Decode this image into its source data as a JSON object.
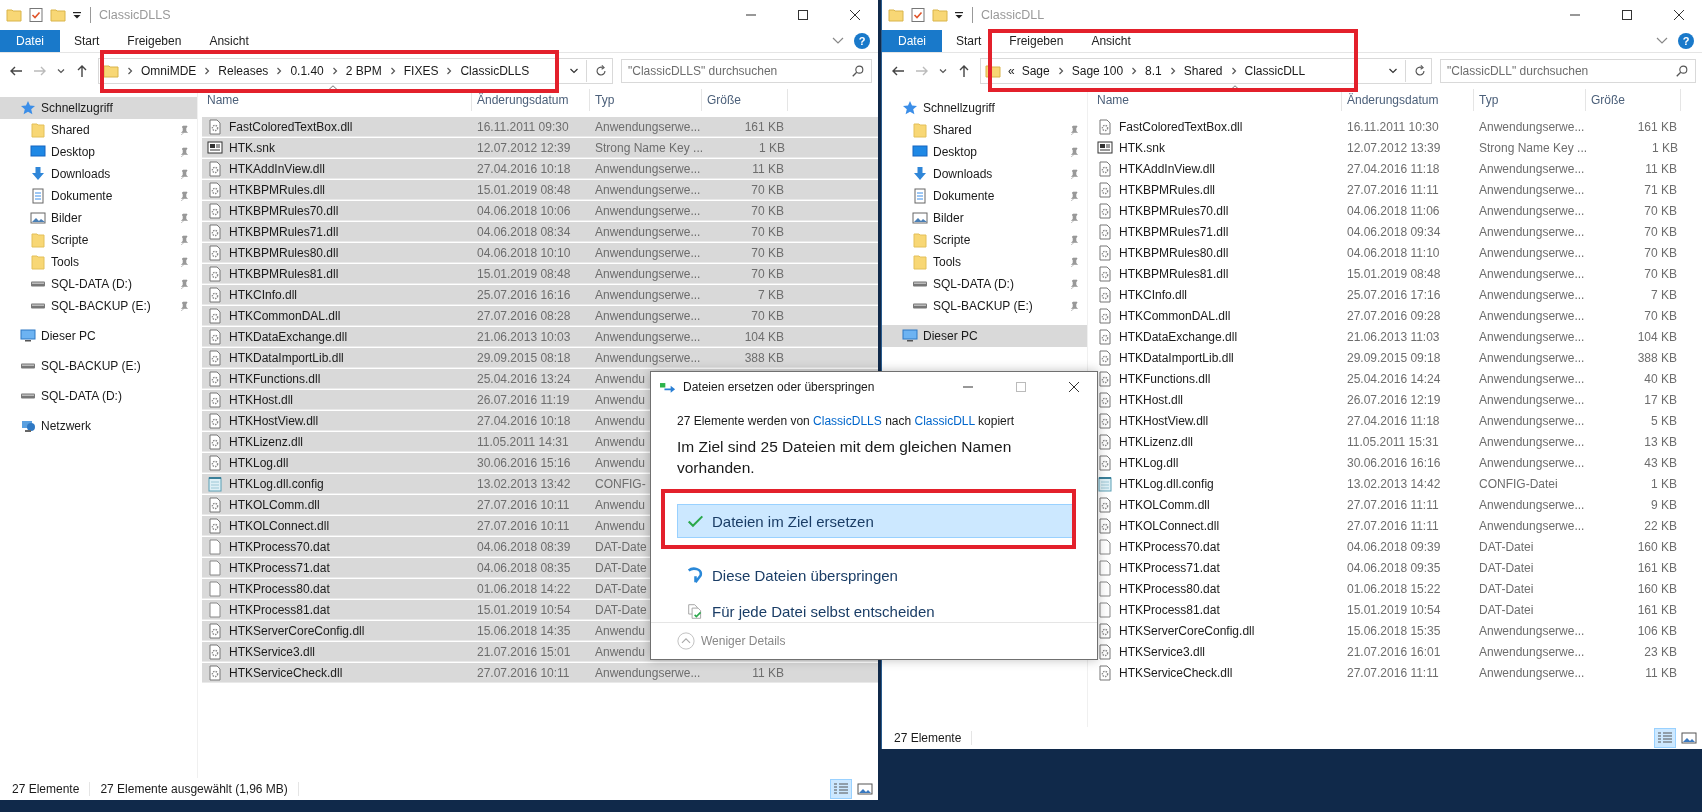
{
  "windows": [
    {
      "title": "ClassicDLLS",
      "ribbon_tabs": [
        {
          "label": "Datei",
          "selected": true
        },
        {
          "label": "Start",
          "selected": false
        },
        {
          "label": "Freigeben",
          "selected": false
        },
        {
          "label": "Ansicht",
          "selected": false
        }
      ],
      "help": "?",
      "address": {
        "segments": [
          "OmniMDE",
          "Releases",
          "0.1.40",
          "2 BPM",
          "FIXES",
          "ClassicDLLS"
        ]
      },
      "search": {
        "placeholder": "\"ClassicDLLS\" durchsuchen"
      },
      "sidebar": [
        {
          "label": "Schnellzugriff",
          "kind": "star",
          "selected": true,
          "children": [
            {
              "label": "Shared",
              "kind": "folder",
              "selected": false,
              "pinned": true
            },
            {
              "label": "Desktop",
              "kind": "desktop",
              "selected": false,
              "pinned": true
            },
            {
              "label": "Downloads",
              "kind": "download",
              "selected": false,
              "pinned": true
            },
            {
              "label": "Dokumente",
              "kind": "document",
              "selected": false,
              "pinned": true
            },
            {
              "label": "Bilder",
              "kind": "pictures",
              "selected": false,
              "pinned": true
            },
            {
              "label": "Scripte",
              "kind": "folder",
              "selected": false,
              "pinned": true
            },
            {
              "label": "Tools",
              "kind": "folder",
              "selected": false,
              "pinned": true
            },
            {
              "label": "SQL-DATA (D:)",
              "kind": "drive",
              "selected": false,
              "pinned": true
            },
            {
              "label": "SQL-BACKUP (E:)",
              "kind": "drive",
              "selected": false,
              "pinned": true
            }
          ]
        },
        {
          "label": "Dieser PC",
          "kind": "pc",
          "selected": false
        },
        {
          "label": "SQL-BACKUP (E:)",
          "kind": "drive",
          "selected": false
        },
        {
          "label": "SQL-DATA (D:)",
          "kind": "drive",
          "selected": false
        },
        {
          "label": "Netzwerk",
          "kind": "network",
          "selected": false
        }
      ],
      "columns": [
        "Name",
        "Änderungsdatum",
        "Typ",
        "Größe"
      ],
      "rows": [
        {
          "name": "FastColoredTextBox.dll",
          "date": "16.11.2011 09:30",
          "type": "Anwendungserwe...",
          "size": "161 KB",
          "kind": "dll",
          "selected": true
        },
        {
          "name": "HTK.snk",
          "date": "12.07.2012 12:39",
          "type": "Strong Name Key ...",
          "size": "1 KB",
          "kind": "snk",
          "selected": true
        },
        {
          "name": "HTKAddInView.dll",
          "date": "27.04.2016 10:18",
          "type": "Anwendungserwe...",
          "size": "11 KB",
          "kind": "dll",
          "selected": true
        },
        {
          "name": "HTKBPMRules.dll",
          "date": "15.01.2019 08:48",
          "type": "Anwendungserwe...",
          "size": "70 KB",
          "kind": "dll",
          "selected": true
        },
        {
          "name": "HTKBPMRules70.dll",
          "date": "04.06.2018 10:06",
          "type": "Anwendungserwe...",
          "size": "70 KB",
          "kind": "dll",
          "selected": true
        },
        {
          "name": "HTKBPMRules71.dll",
          "date": "04.06.2018 08:34",
          "type": "Anwendungserwe...",
          "size": "70 KB",
          "kind": "dll",
          "selected": true
        },
        {
          "name": "HTKBPMRules80.dll",
          "date": "04.06.2018 10:10",
          "type": "Anwendungserwe...",
          "size": "70 KB",
          "kind": "dll",
          "selected": true
        },
        {
          "name": "HTKBPMRules81.dll",
          "date": "15.01.2019 08:48",
          "type": "Anwendungserwe...",
          "size": "70 KB",
          "kind": "dll",
          "selected": true
        },
        {
          "name": "HTKCInfo.dll",
          "date": "25.07.2016 16:16",
          "type": "Anwendungserwe...",
          "size": "7 KB",
          "kind": "dll",
          "selected": true
        },
        {
          "name": "HTKCommonDAL.dll",
          "date": "27.07.2016 08:28",
          "type": "Anwendungserwe...",
          "size": "70 KB",
          "kind": "dll",
          "selected": true
        },
        {
          "name": "HTKDataExchange.dll",
          "date": "21.06.2013 10:03",
          "type": "Anwendungserwe...",
          "size": "104 KB",
          "kind": "dll",
          "selected": true
        },
        {
          "name": "HTKDataImportLib.dll",
          "date": "29.09.2015 08:18",
          "type": "Anwendungserwe...",
          "size": "388 KB",
          "kind": "dll",
          "selected": true
        },
        {
          "name": "HTKFunctions.dll",
          "date": "25.04.2016 13:24",
          "type": "Anwendu",
          "kind": "dll",
          "selected": true
        },
        {
          "name": "HTKHost.dll",
          "date": "26.07.2016 11:19",
          "type": "Anwendu",
          "kind": "dll",
          "selected": true
        },
        {
          "name": "HTKHostView.dll",
          "date": "27.04.2016 10:18",
          "type": "Anwendu",
          "kind": "dll",
          "selected": true
        },
        {
          "name": "HTKLizenz.dll",
          "date": "11.05.2011 14:31",
          "type": "Anwendu",
          "kind": "dll",
          "selected": true
        },
        {
          "name": "HTKLog.dll",
          "date": "30.06.2016 15:16",
          "type": "Anwendu",
          "kind": "dll",
          "selected": true
        },
        {
          "name": "HTKLog.dll.config",
          "date": "13.02.2013 13:42",
          "type": "CONFIG-",
          "kind": "config",
          "selected": true
        },
        {
          "name": "HTKOLComm.dll",
          "date": "27.07.2016 10:11",
          "type": "Anwendu",
          "kind": "dll",
          "selected": true
        },
        {
          "name": "HTKOLConnect.dll",
          "date": "27.07.2016 10:11",
          "type": "Anwendu",
          "kind": "dll",
          "selected": true
        },
        {
          "name": "HTKProcess70.dat",
          "date": "04.06.2018 08:39",
          "type": "DAT-Date",
          "kind": "dat",
          "selected": true
        },
        {
          "name": "HTKProcess71.dat",
          "date": "04.06.2018 08:35",
          "type": "DAT-Date",
          "kind": "dat",
          "selected": true
        },
        {
          "name": "HTKProcess80.dat",
          "date": "01.06.2018 14:22",
          "type": "DAT-Date",
          "kind": "dat",
          "selected": true
        },
        {
          "name": "HTKProcess81.dat",
          "date": "15.01.2019 10:54",
          "type": "DAT-Date",
          "kind": "dat",
          "selected": true
        },
        {
          "name": "HTKServerCoreConfig.dll",
          "date": "15.06.2018 14:35",
          "type": "Anwendu",
          "kind": "dll",
          "selected": true
        },
        {
          "name": "HTKService3.dll",
          "date": "21.07.2016 15:01",
          "type": "Anwendu",
          "kind": "dll",
          "selected": true
        },
        {
          "name": "HTKServiceCheck.dll",
          "date": "27.07.2016 10:11",
          "type": "Anwendungserwe...",
          "size": "11 KB",
          "kind": "dll",
          "selected": true
        }
      ],
      "status": [
        "27 Elemente",
        "27 Elemente ausgewählt (1,96 MB)"
      ],
      "views": [
        {
          "kind": "details",
          "selected": true
        },
        {
          "kind": "tiles",
          "selected": false
        }
      ]
    },
    {
      "title": "ClassicDLL",
      "ribbon_tabs": [
        {
          "label": "Datei",
          "selected": true
        },
        {
          "label": "Start",
          "selected": false
        },
        {
          "label": "Freigeben",
          "selected": false
        },
        {
          "label": "Ansicht",
          "selected": false
        }
      ],
      "help": "?",
      "address": {
        "overflow": "«",
        "segments": [
          "Sage",
          "Sage 100",
          "8.1",
          "Shared",
          "ClassicDLL"
        ]
      },
      "search": {
        "placeholder": "\"ClassicDLL\" durchsuchen"
      },
      "sidebar": [
        {
          "label": "Schnellzugriff",
          "kind": "star",
          "selected": false,
          "children": [
            {
              "label": "Shared",
              "kind": "folder",
              "selected": false,
              "pinned": true
            },
            {
              "label": "Desktop",
              "kind": "desktop",
              "selected": false,
              "pinned": true
            },
            {
              "label": "Downloads",
              "kind": "download",
              "selected": false,
              "pinned": true
            },
            {
              "label": "Dokumente",
              "kind": "document",
              "selected": false,
              "pinned": true
            },
            {
              "label": "Bilder",
              "kind": "pictures",
              "selected": false,
              "pinned": true
            },
            {
              "label": "Scripte",
              "kind": "folder",
              "selected": false,
              "pinned": true
            },
            {
              "label": "Tools",
              "kind": "folder",
              "selected": false,
              "pinned": true
            },
            {
              "label": "SQL-DATA (D:)",
              "kind": "drive",
              "selected": false,
              "pinned": true
            },
            {
              "label": "SQL-BACKUP (E:)",
              "kind": "drive",
              "selected": false,
              "pinned": true
            }
          ]
        },
        {
          "label": "Dieser PC",
          "kind": "pc",
          "selected": true
        }
      ],
      "columns": [
        "Name",
        "Änderungsdatum",
        "Typ",
        "Größe"
      ],
      "rows": [
        {
          "name": "FastColoredTextBox.dll",
          "date": "16.11.2011 10:30",
          "type": "Anwendungserwe...",
          "size": "161 KB",
          "kind": "dll",
          "selected": false
        },
        {
          "name": "HTK.snk",
          "date": "12.07.2012 13:39",
          "type": "Strong Name Key ...",
          "size": "1 KB",
          "kind": "snk",
          "selected": false
        },
        {
          "name": "HTKAddInView.dll",
          "date": "27.04.2016 11:18",
          "type": "Anwendungserwe...",
          "size": "11 KB",
          "kind": "dll",
          "selected": false
        },
        {
          "name": "HTKBPMRules.dll",
          "date": "27.07.2016 11:11",
          "type": "Anwendungserwe...",
          "size": "71 KB",
          "kind": "dll",
          "selected": false
        },
        {
          "name": "HTKBPMRules70.dll",
          "date": "04.06.2018 11:06",
          "type": "Anwendungserwe...",
          "size": "70 KB",
          "kind": "dll",
          "selected": false
        },
        {
          "name": "HTKBPMRules71.dll",
          "date": "04.06.2018 09:34",
          "type": "Anwendungserwe...",
          "size": "70 KB",
          "kind": "dll",
          "selected": false
        },
        {
          "name": "HTKBPMRules80.dll",
          "date": "04.06.2018 11:10",
          "type": "Anwendungserwe...",
          "size": "70 KB",
          "kind": "dll",
          "selected": false
        },
        {
          "name": "HTKBPMRules81.dll",
          "date": "15.01.2019 08:48",
          "type": "Anwendungserwe...",
          "size": "70 KB",
          "kind": "dll",
          "selected": false
        },
        {
          "name": "HTKCInfo.dll",
          "date": "25.07.2016 17:16",
          "type": "Anwendungserwe...",
          "size": "7 KB",
          "kind": "dll",
          "selected": false
        },
        {
          "name": "HTKCommonDAL.dll",
          "date": "27.07.2016 09:28",
          "type": "Anwendungserwe...",
          "size": "70 KB",
          "kind": "dll",
          "selected": false
        },
        {
          "name": "HTKDataExchange.dll",
          "date": "21.06.2013 11:03",
          "type": "Anwendungserwe...",
          "size": "104 KB",
          "kind": "dll",
          "selected": false
        },
        {
          "name": "HTKDataImportLib.dll",
          "date": "29.09.2015 09:18",
          "type": "Anwendungserwe...",
          "size": "388 KB",
          "kind": "dll",
          "selected": false
        },
        {
          "name": "HTKFunctions.dll",
          "date": "25.04.2016 14:24",
          "type": "Anwendungserwe...",
          "size": "40 KB",
          "kind": "dll",
          "selected": false
        },
        {
          "name": "HTKHost.dll",
          "date": "26.07.2016 12:19",
          "type": "Anwendungserwe...",
          "size": "17 KB",
          "kind": "dll",
          "selected": false
        },
        {
          "name": "HTKHostView.dll",
          "date": "27.04.2016 11:18",
          "type": "Anwendungserwe...",
          "size": "5 KB",
          "kind": "dll",
          "selected": false
        },
        {
          "name": "HTKLizenz.dll",
          "date": "11.05.2011 15:31",
          "type": "Anwendungserwe...",
          "size": "13 KB",
          "kind": "dll",
          "selected": false
        },
        {
          "name": "HTKLog.dll",
          "date": "30.06.2016 16:16",
          "type": "Anwendungserwe...",
          "size": "43 KB",
          "kind": "dll",
          "selected": false
        },
        {
          "name": "HTKLog.dll.config",
          "date": "13.02.2013 14:42",
          "type": "CONFIG-Datei",
          "size": "1 KB",
          "kind": "config",
          "selected": false
        },
        {
          "name": "HTKOLComm.dll",
          "date": "27.07.2016 11:11",
          "type": "Anwendungserwe...",
          "size": "9 KB",
          "kind": "dll",
          "selected": false
        },
        {
          "name": "HTKOLConnect.dll",
          "date": "27.07.2016 11:11",
          "type": "Anwendungserwe...",
          "size": "22 KB",
          "kind": "dll",
          "selected": false
        },
        {
          "name": "HTKProcess70.dat",
          "date": "04.06.2018 09:39",
          "type": "DAT-Datei",
          "size": "160 KB",
          "kind": "dat",
          "selected": false
        },
        {
          "name": "HTKProcess71.dat",
          "date": "04.06.2018 09:35",
          "type": "DAT-Datei",
          "size": "161 KB",
          "kind": "dat",
          "selected": false
        },
        {
          "name": "HTKProcess80.dat",
          "date": "01.06.2018 15:22",
          "type": "DAT-Datei",
          "size": "160 KB",
          "kind": "dat",
          "selected": false
        },
        {
          "name": "HTKProcess81.dat",
          "date": "15.01.2019 10:54",
          "type": "DAT-Datei",
          "size": "161 KB",
          "kind": "dat",
          "selected": false
        },
        {
          "name": "HTKServerCoreConfig.dll",
          "date": "15.06.2018 15:35",
          "type": "Anwendungserwe...",
          "size": "106 KB",
          "kind": "dll",
          "selected": false
        },
        {
          "name": "HTKService3.dll",
          "date": "21.07.2016 16:01",
          "type": "Anwendungserwe...",
          "size": "23 KB",
          "kind": "dll",
          "selected": false
        },
        {
          "name": "HTKServiceCheck.dll",
          "date": "27.07.2016 11:11",
          "type": "Anwendungserwe...",
          "size": "11 KB",
          "kind": "dll",
          "selected": false
        }
      ],
      "status": [
        "27 Elemente"
      ],
      "views": [
        {
          "kind": "details",
          "selected": true
        },
        {
          "kind": "tiles",
          "selected": false
        }
      ]
    }
  ],
  "dialog": {
    "title": "Dateien ersetzen oder überspringen",
    "message": {
      "before": "27 Elemente werden von",
      "source": "ClassicDLLS",
      "middle": "nach",
      "target": "ClassicDLL",
      "after": "kopiert"
    },
    "heading": "Im Ziel sind 25 Dateien mit dem gleichen Namen vorhanden.",
    "options": [
      {
        "label": "Dateien im Ziel ersetzen",
        "kind": "replace",
        "selected": true
      },
      {
        "label": "Diese Dateien überspringen",
        "kind": "skip",
        "selected": false
      },
      {
        "label": "Für jede Datei selbst entscheiden",
        "kind": "decide",
        "selected": false
      }
    ],
    "footer": "Weniger Details"
  }
}
